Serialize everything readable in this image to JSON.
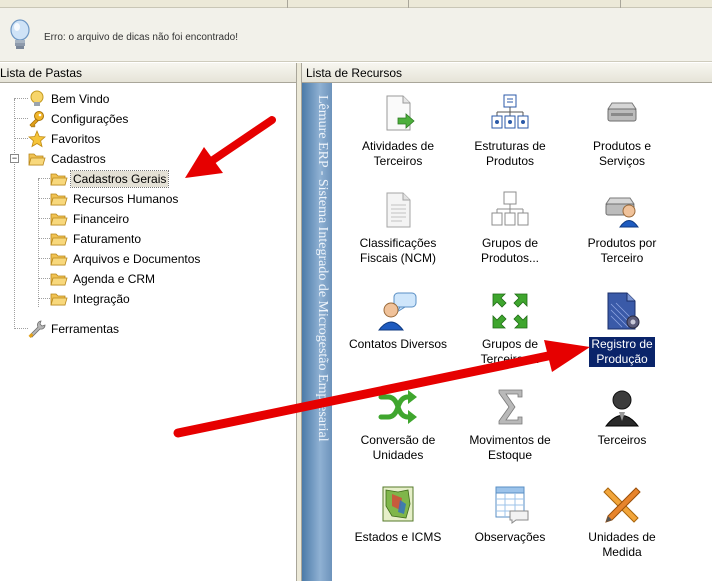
{
  "tip": {
    "message": "Erro: o arquivo de dicas não foi encontrado!"
  },
  "left_panel": {
    "header": "Lista de Pastas",
    "items": [
      {
        "label": "Bem Vindo"
      },
      {
        "label": "Configurações"
      },
      {
        "label": "Favoritos"
      },
      {
        "label": "Cadastros"
      },
      {
        "label": "Cadastros Gerais"
      },
      {
        "label": "Recursos Humanos"
      },
      {
        "label": "Financeiro"
      },
      {
        "label": "Faturamento"
      },
      {
        "label": "Arquivos e Documentos"
      },
      {
        "label": "Agenda e CRM"
      },
      {
        "label": "Integração"
      },
      {
        "label": "Ferramentas"
      }
    ]
  },
  "right_panel": {
    "header": "Lista de Recursos",
    "sidebar_text": "Lêmure ERP - Sistema Integrado de Microgestão Empresarial",
    "resources": [
      {
        "line1": "Atividades de",
        "line2": "Terceiros",
        "icon": "document-arrow-icon"
      },
      {
        "line1": "Estruturas de",
        "line2": "Produtos",
        "icon": "structure-icon"
      },
      {
        "line1": "Produtos e",
        "line2": "Serviços",
        "icon": "drive-icon"
      },
      {
        "line1": "Classificações",
        "line2": "Fiscais (NCM)",
        "icon": "document-icon"
      },
      {
        "line1": "Grupos de",
        "line2": "Produtos...",
        "icon": "hierarchy-icon"
      },
      {
        "line1": "Produtos por",
        "line2": "Terceiro",
        "icon": "drive-person-icon"
      },
      {
        "line1": "Contatos Diversos",
        "line2": "",
        "icon": "contact-icon"
      },
      {
        "line1": "Grupos de",
        "line2": "Terceiros...",
        "icon": "expand-icon"
      },
      {
        "line1": "Registro de",
        "line2": "Produção",
        "icon": "production-icon"
      },
      {
        "line1": "Conversão de",
        "line2": "Unidades",
        "icon": "shuffle-icon"
      },
      {
        "line1": "Movimentos de",
        "line2": "Estoque",
        "icon": "sigma-icon"
      },
      {
        "line1": "Terceiros",
        "line2": "",
        "icon": "person-icon"
      },
      {
        "line1": "Estados e ICMS",
        "line2": "",
        "icon": "map-icon"
      },
      {
        "line1": "Observações",
        "line2": "",
        "icon": "table-icon"
      },
      {
        "line1": "Unidades de",
        "line2": "Medida",
        "icon": "tools-icon"
      }
    ],
    "selected": "Registro de Produção"
  },
  "colors": {
    "selection": "#0a246a",
    "arrow": "#e60000",
    "folder": "#f3c34d"
  }
}
